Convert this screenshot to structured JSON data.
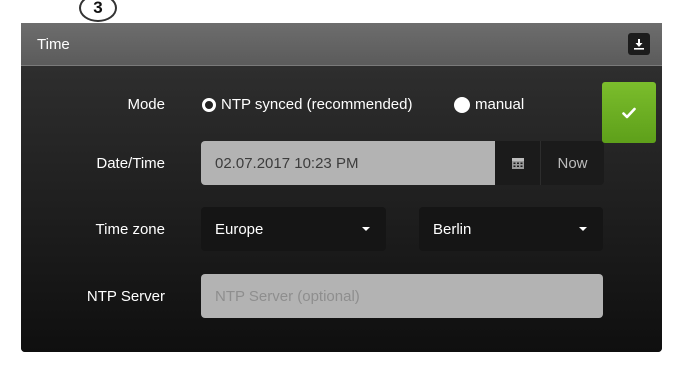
{
  "panel": {
    "title": "Time",
    "step_badge": "3",
    "export_icon": "download-icon"
  },
  "form": {
    "mode": {
      "label": "Mode",
      "options": [
        {
          "label": "NTP synced (recommended)",
          "selected": true
        },
        {
          "label": "manual",
          "selected": false
        }
      ]
    },
    "datetime": {
      "label": "Date/Time",
      "value": "02.07.2017 10:23 PM",
      "calendar_icon": "calendar-icon",
      "now_label": "Now"
    },
    "timezone": {
      "label": "Time zone",
      "region": "Europe",
      "city": "Berlin"
    },
    "ntp_server": {
      "label": "NTP Server",
      "value": "",
      "placeholder": "NTP Server (optional)"
    },
    "confirm_icon": "checkmark-icon"
  },
  "colors": {
    "accent_green": "#6aad22",
    "panel_bg": "#222222",
    "header_bg": "#636363"
  }
}
